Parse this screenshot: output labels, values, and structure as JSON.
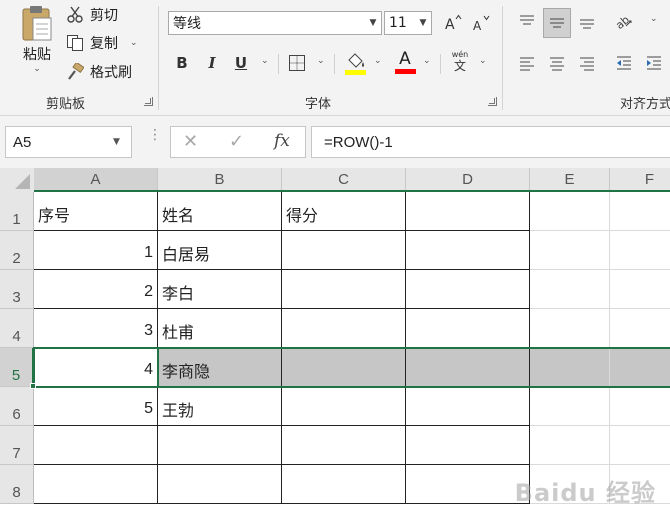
{
  "ribbon": {
    "clipboard": {
      "paste_label": "粘贴",
      "cut_label": "剪切",
      "copy_label": "复制",
      "format_painter_label": "格式刷",
      "group_label": "剪贴板"
    },
    "font": {
      "font_name": "等线",
      "font_size": "11",
      "bold": "B",
      "italic": "I",
      "underline": "U",
      "font_color_letter": "A",
      "phonetic_top": "wén",
      "phonetic_bottom": "文",
      "group_label": "字体",
      "fill_color": "#ffff00",
      "font_color": "#ff0000"
    },
    "alignment": {
      "group_label": "对齐方式"
    }
  },
  "formula_bar": {
    "name_box": "A5",
    "cancel_symbol": "✕",
    "enter_symbol": "✓",
    "fx_label": "fx",
    "formula": "=ROW()-1"
  },
  "sheet": {
    "columns": [
      "A",
      "B",
      "C",
      "D",
      "E",
      "F"
    ],
    "rows": [
      "1",
      "2",
      "3",
      "4",
      "5",
      "6",
      "7",
      "8"
    ],
    "header_row": {
      "a": "序号",
      "b": "姓名",
      "c": "得分",
      "d": ""
    },
    "data": [
      {
        "a": "1",
        "b": "白居易"
      },
      {
        "a": "2",
        "b": "李白"
      },
      {
        "a": "3",
        "b": "杜甫"
      },
      {
        "a": "4",
        "b": "李商隐"
      },
      {
        "a": "5",
        "b": "王勃"
      }
    ],
    "active_cell": "A5",
    "accent_color": "#217346"
  },
  "watermark": "Baidu 经验"
}
